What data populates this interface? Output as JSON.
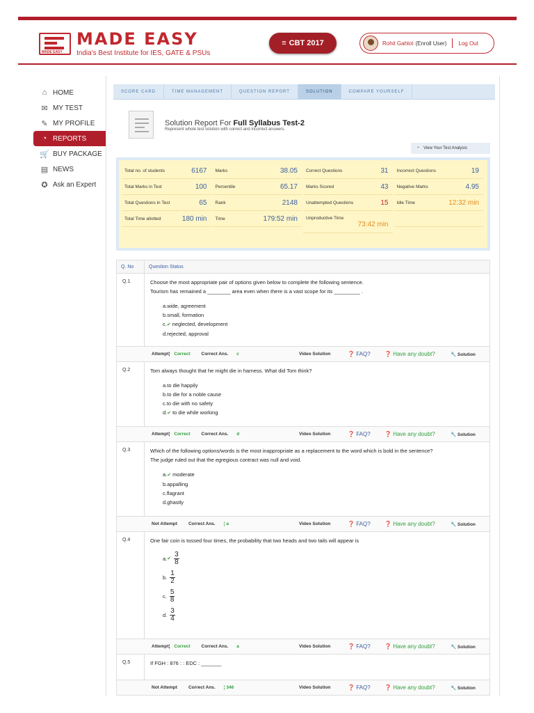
{
  "header": {
    "logo_small": "MADE EASY",
    "logo_text": "MADE EASY",
    "tagline": "India's Best Institute for IES, GATE & PSUs",
    "cbt_label": "CBT 2017",
    "user_name": "Rohit Gahlot",
    "user_role": "(Enroll User)",
    "logout": "Log Out"
  },
  "sidebar": {
    "items": [
      {
        "label": "HOME",
        "icon": "home-icon",
        "glyph": "⌂"
      },
      {
        "label": "MY TEST",
        "icon": "test-icon",
        "glyph": "✉"
      },
      {
        "label": "MY PROFILE",
        "icon": "profile-icon",
        "glyph": "✎"
      },
      {
        "label": "REPORTS",
        "icon": "reports-icon",
        "glyph": "◔"
      },
      {
        "label": "BUY PACKAGE",
        "icon": "cart-icon",
        "glyph": "🛒"
      },
      {
        "label": "NEWS",
        "icon": "news-icon",
        "glyph": "▤"
      },
      {
        "label": "Ask an Expert",
        "icon": "expert-icon",
        "glyph": "✪"
      }
    ]
  },
  "tabs": [
    "SCORE CARD",
    "TIME MANAGEMENT",
    "QUESTION REPORT",
    "SOLUTION",
    "COMPARE YOURSELF"
  ],
  "report": {
    "title_prefix": "Solution Report For",
    "title_bold": "Full Syllabus Test-2",
    "subtitle": "Represent whole test solution with correct and incorrect answers.",
    "analysis_btn": "View Your Test Analysis"
  },
  "summary": [
    [
      {
        "l": "Total no. of students",
        "v": "6167"
      },
      {
        "l": "Marks",
        "v": "38.05"
      },
      {
        "l": "Correct Questions",
        "v": "31"
      },
      {
        "l": "Incorrect Questions",
        "v": "19"
      }
    ],
    [
      {
        "l": "Total Marks in Test",
        "v": "100"
      },
      {
        "l": "Percentile",
        "v": "65.17"
      },
      {
        "l": "Marks Scored",
        "v": "43"
      },
      {
        "l": "Negative Marks",
        "v": "4.95"
      }
    ],
    [
      {
        "l": "Total Questions in Test",
        "v": "65"
      },
      {
        "l": "Rank",
        "v": "2148"
      },
      {
        "l": "Unattempted Questions",
        "v": "15"
      },
      {
        "l": "Idle Time",
        "v": "12:32 min"
      }
    ],
    [
      {
        "l": "Total Time allotted",
        "v": "180 min"
      },
      {
        "l": "Time",
        "v": "179:52 min"
      },
      {
        "l": "Unproductive Time",
        "v": "73:42 min"
      },
      {
        "l": "",
        "v": ""
      }
    ]
  ],
  "table": {
    "col_no": "Q. No",
    "col_status": "Question Status"
  },
  "questions": [
    {
      "no": "Q.1",
      "text": [
        "Choose the most appropriate pair of options given below to complete the following sentence.",
        "Tourism has remained a ________ area even when there is a vast scope for its _________ ."
      ],
      "options": [
        "a.wide, agreement",
        "b.small, formation",
        "c.neglected, development",
        "d.rejected, approval"
      ],
      "correct_index": 2,
      "attempt": "Attempt",
      "status": "Correct",
      "correct_label": "Correct Ans.",
      "answer": "c"
    },
    {
      "no": "Q.2",
      "text": [
        "Tom always thought that he might die in harness. What did Tom think?"
      ],
      "options": [
        "a.to die happily",
        "b.to die for a noble cause",
        "c.to die with no safety",
        "d.to die while working"
      ],
      "correct_index": 3,
      "attempt": "Attempt",
      "status": "Correct",
      "correct_label": "Correct Ans.",
      "answer": "d"
    },
    {
      "no": "Q.3",
      "text": [
        "Which of the following options/words is the most inappropriate as a replacement to the word which is bold in the sentence?",
        "The judge ruled out that the egregious contract was null and void."
      ],
      "options": [
        "a.moderate",
        "b.appalling",
        "c.flagrant",
        "d.ghastly"
      ],
      "correct_index": 0,
      "attempt": "Not Attempt",
      "status": "",
      "correct_label": "Correct Ans.",
      "answer": "a"
    },
    {
      "no": "Q.4",
      "text": [
        "One fair coin is tossed four times, the probability that two heads and two tails will appear is"
      ],
      "fractions": [
        {
          "p": "a.",
          "n": "3",
          "d": "8"
        },
        {
          "p": "b.",
          "n": "1",
          "d": "2"
        },
        {
          "p": "c.",
          "n": "5",
          "d": "8"
        },
        {
          "p": "d.",
          "n": "3",
          "d": "4"
        }
      ],
      "correct_index": 0,
      "attempt": "Attempt",
      "status": "Correct",
      "correct_label": "Correct Ans.",
      "answer": "a"
    },
    {
      "no": "Q.5",
      "text": [
        "If FGH : 876 : : EDC : _______"
      ],
      "attempt": "Not Attempt",
      "status": "",
      "correct_label": "Correct Ans.",
      "answer": "346"
    }
  ],
  "footer": {
    "video": "Video Solution",
    "faq": "FAQ?",
    "doubt": "Have any doubt?",
    "solution": "Solution"
  }
}
